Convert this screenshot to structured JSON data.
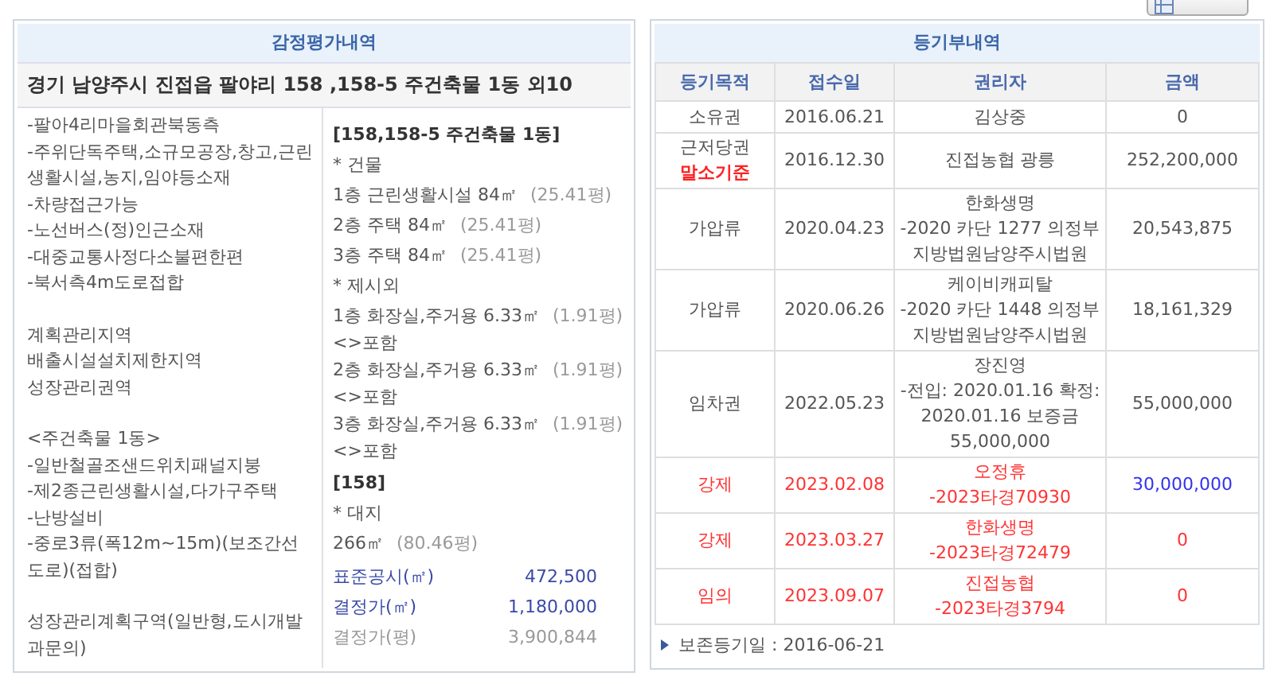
{
  "appraisal": {
    "header": "감정평가내역",
    "address": "경기 남양주시 진접읍 팔야리 158 ,158-5 주건축물 1동 외10",
    "description_groups": [
      [
        "-팔아4리마을회관북동측",
        "-주위단독주택,소규모공장,창고,근린생활시설,농지,임야등소재",
        "-차량접근가능",
        "-노선버스(정)인근소재",
        "-대중교통사정다소불편한편",
        "-북서측4m도로접합"
      ],
      [
        "계획관리지역",
        "배출시설설치제한지역",
        "성장관리권역"
      ],
      [
        "<주건축물 1동>",
        "-일반철골조샌드위치패널지붕",
        "-제2종근린생활시설,다가구주택",
        "-난방설비",
        "-중로3류(폭12m~15m)(보조간선도로)(접합)"
      ],
      [
        "성장관리계획구역(일반형,도시개발과문의)"
      ]
    ],
    "details": [
      {
        "kind": "heading",
        "text": "[158,158-5 주건축물 1동]"
      },
      {
        "kind": "label",
        "text": "* 건물"
      },
      {
        "kind": "area",
        "text": "1층 근린생활시설 84㎡",
        "sub": "(25.41평)"
      },
      {
        "kind": "area",
        "text": "2층 주택 84㎡",
        "sub": "(25.41평)"
      },
      {
        "kind": "area",
        "text": "3층 주택 84㎡",
        "sub": "(25.41평)"
      },
      {
        "kind": "label",
        "text": "* 제시외"
      },
      {
        "kind": "area",
        "text": "1층 화장실,주거용 6.33㎡",
        "sub": "(1.91평)"
      },
      {
        "kind": "note",
        "text": "<>포함"
      },
      {
        "kind": "area",
        "text": "2층 화장실,주거용 6.33㎡",
        "sub": "(1.91평)"
      },
      {
        "kind": "note",
        "text": "<>포함"
      },
      {
        "kind": "area",
        "text": "3층 화장실,주거용 6.33㎡",
        "sub": "(1.91평)"
      },
      {
        "kind": "note",
        "text": "<>포함"
      },
      {
        "kind": "heading",
        "text": "[158]"
      },
      {
        "kind": "label",
        "text": "* 대지"
      },
      {
        "kind": "area",
        "text": "266㎡",
        "sub": "(80.46평)"
      }
    ],
    "prices": [
      {
        "label": "표준공시(㎡)",
        "value": "472,500",
        "muted": false
      },
      {
        "label": "결정가(㎡)",
        "value": "1,180,000",
        "muted": false
      },
      {
        "label": "결정가(평)",
        "value": "3,900,844",
        "muted": true
      }
    ]
  },
  "registry": {
    "header": "등기부내역",
    "columns": [
      "등기목적",
      "접수일",
      "권리자",
      "금액"
    ],
    "rows": [
      {
        "purpose": "소유권",
        "date": "2016.06.21",
        "holder": [
          "김상중"
        ],
        "amount": "0",
        "color": "#555555",
        "amount_emphasis": false
      },
      {
        "purpose": "근저당권",
        "purpose_note": "말소기준",
        "date": "2016.12.30",
        "holder": [
          "진접농협 광릉"
        ],
        "amount": "252,200,000",
        "color": "#555555",
        "amount_emphasis": false
      },
      {
        "purpose": "가압류",
        "date": "2020.04.23",
        "holder": [
          "한화생명",
          "-2020 카단 1277 의정부",
          "지방법원남양주시법원"
        ],
        "amount": "20,543,875",
        "color": "#555555",
        "amount_emphasis": false
      },
      {
        "purpose": "가압류",
        "date": "2020.06.26",
        "holder": [
          "케이비캐피탈",
          "-2020 카단 1448 의정부",
          "지방법원남양주시법원"
        ],
        "amount": "18,161,329",
        "color": "#555555",
        "amount_emphasis": false
      },
      {
        "purpose": "임차권",
        "date": "2022.05.23",
        "holder": [
          "장진영",
          "-전입: 2020.01.16 확정:",
          "2020.01.16 보증금",
          "55,000,000"
        ],
        "amount": "55,000,000",
        "color": "#555555",
        "amount_emphasis": false
      },
      {
        "purpose": "강제",
        "date": "2023.02.08",
        "holder": [
          "오정휴",
          "-2023타경70930"
        ],
        "amount": "30,000,000",
        "color": "#ff3333",
        "amount_emphasis": true
      },
      {
        "purpose": "강제",
        "date": "2023.03.27",
        "holder": [
          "한화생명",
          "-2023타경72479"
        ],
        "amount": "0",
        "color": "#ff3333",
        "amount_emphasis": false
      },
      {
        "purpose": "임의",
        "date": "2023.09.07",
        "holder": [
          "진접농협",
          "-2023타경3794"
        ],
        "amount": "0",
        "color": "#ff3333",
        "amount_emphasis": false
      }
    ],
    "footnote": "보존등기일 : 2016-06-21"
  }
}
